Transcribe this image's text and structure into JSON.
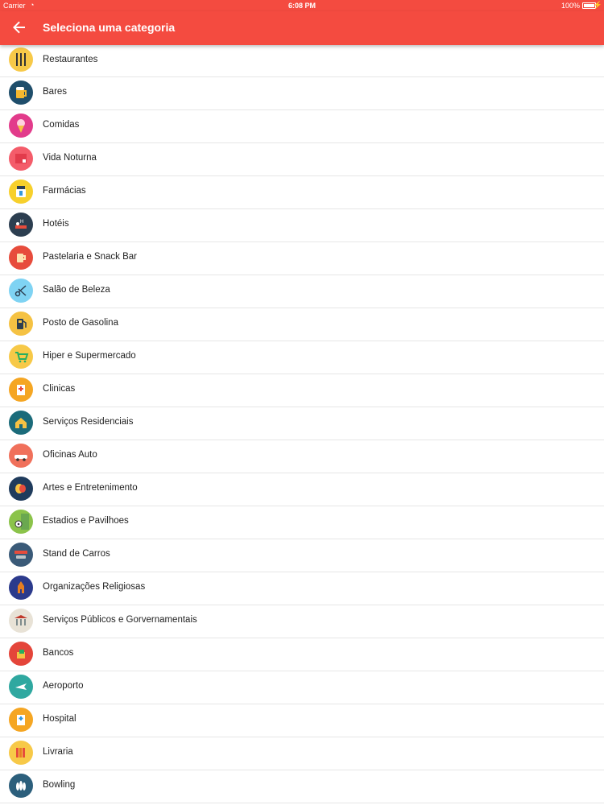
{
  "status_bar": {
    "carrier": "Carrier",
    "time": "6:08 PM",
    "battery": "100%"
  },
  "app_bar": {
    "title": "Seleciona uma categoria",
    "back_icon": "arrow-back-icon",
    "color": "#f44b40"
  },
  "categories": [
    {
      "label": "Restaurantes",
      "icon": "cutlery-icon",
      "color": "#f7c948"
    },
    {
      "label": "Bares",
      "icon": "beer-icon",
      "color": "#1f4e6b"
    },
    {
      "label": "Comidas",
      "icon": "ice-cream-icon",
      "color": "#e23b8b"
    },
    {
      "label": "Vida Noturna",
      "icon": "nightlife-icon",
      "color": "#f45c6a"
    },
    {
      "label": "Farmácias",
      "icon": "pharmacy-icon",
      "color": "#f7d02c"
    },
    {
      "label": "Hotéis",
      "icon": "hotel-icon",
      "color": "#2c3e50"
    },
    {
      "label": "Pastelaria e Snack Bar",
      "icon": "coffee-icon",
      "color": "#e74c3c"
    },
    {
      "label": "Salão de Beleza",
      "icon": "scissors-icon",
      "color": "#7fd3f3"
    },
    {
      "label": "Posto de Gasolina",
      "icon": "gas-pump-icon",
      "color": "#f5c243"
    },
    {
      "label": "Hiper e Supermercado",
      "icon": "shopping-cart-icon",
      "color": "#f7c948"
    },
    {
      "label": "Clinicas",
      "icon": "clinic-icon",
      "color": "#f5a623"
    },
    {
      "label": "Serviços Residenciais",
      "icon": "house-icon",
      "color": "#1b6b7a"
    },
    {
      "label": "Oficinas Auto",
      "icon": "car-icon",
      "color": "#f0705b"
    },
    {
      "label": "Artes e Entretenimento",
      "icon": "theater-masks-icon",
      "color": "#1f3b5c"
    },
    {
      "label": "Estadios e Pavilhoes",
      "icon": "soccer-ball-icon",
      "color": "#8bc34a"
    },
    {
      "label": "Stand de Carros",
      "icon": "car-dealer-icon",
      "color": "#3a5a78"
    },
    {
      "label": "Organizações Religiosas",
      "icon": "church-icon",
      "color": "#2b3a8c"
    },
    {
      "label": "Serviços Públicos e Gorvernamentais",
      "icon": "government-building-icon",
      "color": "#e8e2d6"
    },
    {
      "label": "Bancos",
      "icon": "bank-icon",
      "color": "#e4453a"
    },
    {
      "label": "Aeroporto",
      "icon": "airplane-icon",
      "color": "#2fa8a0"
    },
    {
      "label": "Hospital",
      "icon": "hospital-icon",
      "color": "#f5a623"
    },
    {
      "label": "Livraria",
      "icon": "books-icon",
      "color": "#f7c948"
    },
    {
      "label": "Bowling",
      "icon": "bowling-icon",
      "color": "#2c5f7c"
    }
  ]
}
